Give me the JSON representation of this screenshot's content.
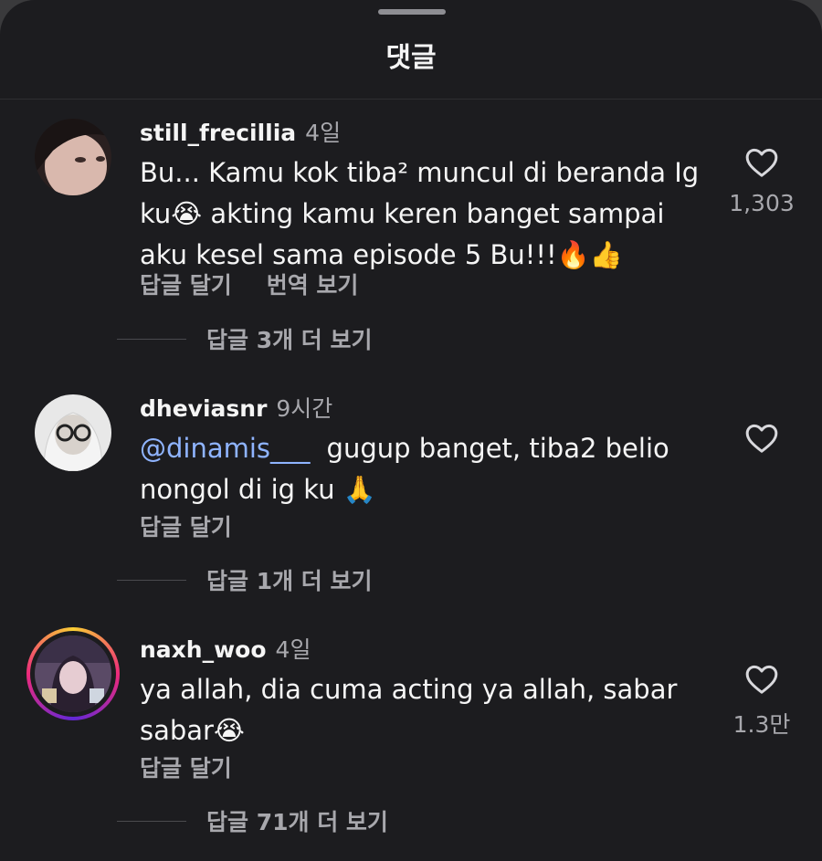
{
  "sheet": {
    "title": "댓글"
  },
  "comments": [
    {
      "username": "still_frecillia",
      "time": "4일",
      "lines": [
        "Bu... Kamu kok tiba² muncul di beranda Ig",
        "ku😭 akting kamu keren banget sampai",
        "aku kesel sama episode 5 Bu!!!🔥👍"
      ],
      "likes": "1,303",
      "reply_label": "답글 달기",
      "translate_label": "번역 보기",
      "more_replies": "답글 3개 더 보기"
    },
    {
      "username": "dheviasnr",
      "time": "9시간",
      "mention": "@dinamis___",
      "lines": [
        "gugup banget, tiba2 belio",
        "nongol di ig ku 🙏"
      ],
      "likes": "",
      "reply_label": "답글 달기",
      "more_replies": "답글 1개 더 보기"
    },
    {
      "username": "naxh_woo",
      "time": "4일",
      "lines": [
        "ya allah, dia cuma acting ya allah, sabar",
        "sabar😭"
      ],
      "likes": "1.3만",
      "reply_label": "답글 달기",
      "more_replies": "답글 71개 더 보기"
    }
  ],
  "icons": {
    "like": "heart-outline-icon"
  }
}
